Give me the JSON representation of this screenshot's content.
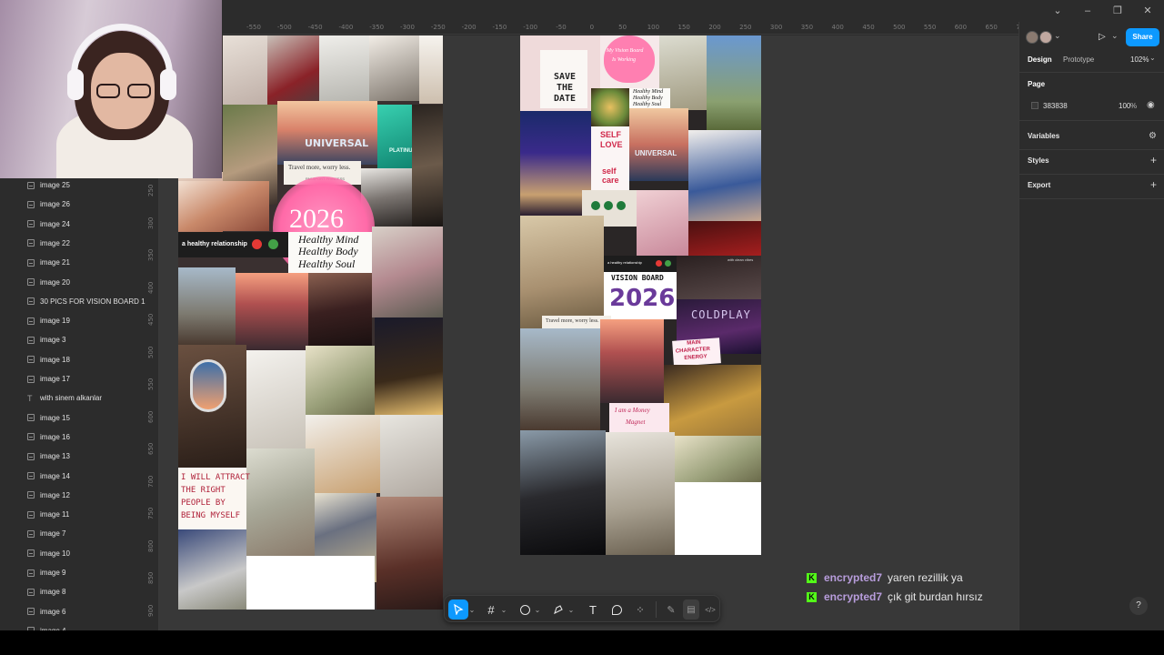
{
  "webcam": {
    "label": "streamer webcam"
  },
  "ruler": {
    "top_ticks": [
      "-550",
      "-500",
      "-450",
      "-400",
      "-350",
      "-300",
      "-250",
      "-200",
      "-150",
      "-100",
      "-50",
      "0",
      "50",
      "100",
      "150",
      "200",
      "250",
      "300",
      "350",
      "400",
      "450",
      "500",
      "550",
      "600",
      "650",
      "700",
      "750"
    ],
    "left_ticks": [
      "250",
      "300",
      "350",
      "400",
      "450",
      "500",
      "550",
      "600",
      "650",
      "700",
      "750",
      "800",
      "850",
      "900"
    ]
  },
  "layers": [
    {
      "label": "image 25",
      "kind": "image"
    },
    {
      "label": "image 26",
      "kind": "image"
    },
    {
      "label": "image 24",
      "kind": "image"
    },
    {
      "label": "image 22",
      "kind": "image"
    },
    {
      "label": "image 21",
      "kind": "image"
    },
    {
      "label": "image 20",
      "kind": "image"
    },
    {
      "label": "30 PICS FOR VISION BOARD 1",
      "kind": "image"
    },
    {
      "label": "image 19",
      "kind": "image"
    },
    {
      "label": "image 3",
      "kind": "image"
    },
    {
      "label": "image 18",
      "kind": "image"
    },
    {
      "label": "image 17",
      "kind": "image"
    },
    {
      "label": "with sinem alkanlar",
      "kind": "text"
    },
    {
      "label": "image 15",
      "kind": "image"
    },
    {
      "label": "image 16",
      "kind": "image"
    },
    {
      "label": "image 13",
      "kind": "image"
    },
    {
      "label": "image 14",
      "kind": "image"
    },
    {
      "label": "image 12",
      "kind": "image"
    },
    {
      "label": "image 11",
      "kind": "image"
    },
    {
      "label": "image 7",
      "kind": "image"
    },
    {
      "label": "image 10",
      "kind": "image"
    },
    {
      "label": "image 9",
      "kind": "image"
    },
    {
      "label": "image 8",
      "kind": "image"
    },
    {
      "label": "image 6",
      "kind": "image"
    },
    {
      "label": "image 4",
      "kind": "image"
    }
  ],
  "right_panel": {
    "tab_design": "Design",
    "tab_prototype": "Prototype",
    "zoom": "102%",
    "share": "Share",
    "page_section": "Page",
    "page_color": "383838",
    "page_opacity": "100",
    "page_opacity_unit": "%",
    "variables": "Variables",
    "styles": "Styles",
    "export": "Export",
    "accent": "#0d99ff"
  },
  "collage_left": {
    "travel": "Travel more, worry less.",
    "passport": "PASSPORT PRINCESS",
    "year": "2026",
    "relationship": "a healthy relationship",
    "mind": "Healthy Mind",
    "body": "Healthy Body",
    "soul": "Healthy Soul",
    "attract_1": "I WILL ATTRACT",
    "attract_2": "THE RIGHT",
    "attract_3": "PEOPLE BY",
    "attract_4": "BEING MYSELF",
    "universal": "UNIVERSAL",
    "platinum": "PLATINUM"
  },
  "collage_right": {
    "save_1": "SAVE",
    "save_2": "THE",
    "save_3": "DATE",
    "heart_1": "My Vision Board",
    "heart_2": "Is Working",
    "mind": "Healthy Mind",
    "body": "Healthy Body",
    "soul": "Healthy Soul",
    "self_love_1": "SELF",
    "self_love_2": "LOVE",
    "self_care_1": "self",
    "self_care_2": "care",
    "relationship": "a healthy relationship",
    "vision": "VISION BOARD",
    "year": "2026",
    "coldplay": "COLDPLAY",
    "travel": "Travel more, worry less.",
    "passport": "PASSPORT PRINCESS",
    "main_1": "MAIN",
    "main_2": "CHARACTER",
    "main_3": "ENERGY",
    "money_1": "I am a Money",
    "money_2": "Magnet",
    "universal": "UNIVERSAL",
    "clean": "with clean vibes"
  },
  "chat": [
    {
      "user": "encrypted7",
      "message": "yaren rezillik ya"
    },
    {
      "user": "encrypted7",
      "message": "çık git burdan hırsız"
    }
  ],
  "toolbar": {
    "move": "move-tool",
    "frame": "frame-tool",
    "shape": "ellipse-tool",
    "pen": "pen-tool",
    "text": "T",
    "comment": "comment-tool",
    "actions": "actions-tool",
    "dev": "</>"
  },
  "help": "?"
}
